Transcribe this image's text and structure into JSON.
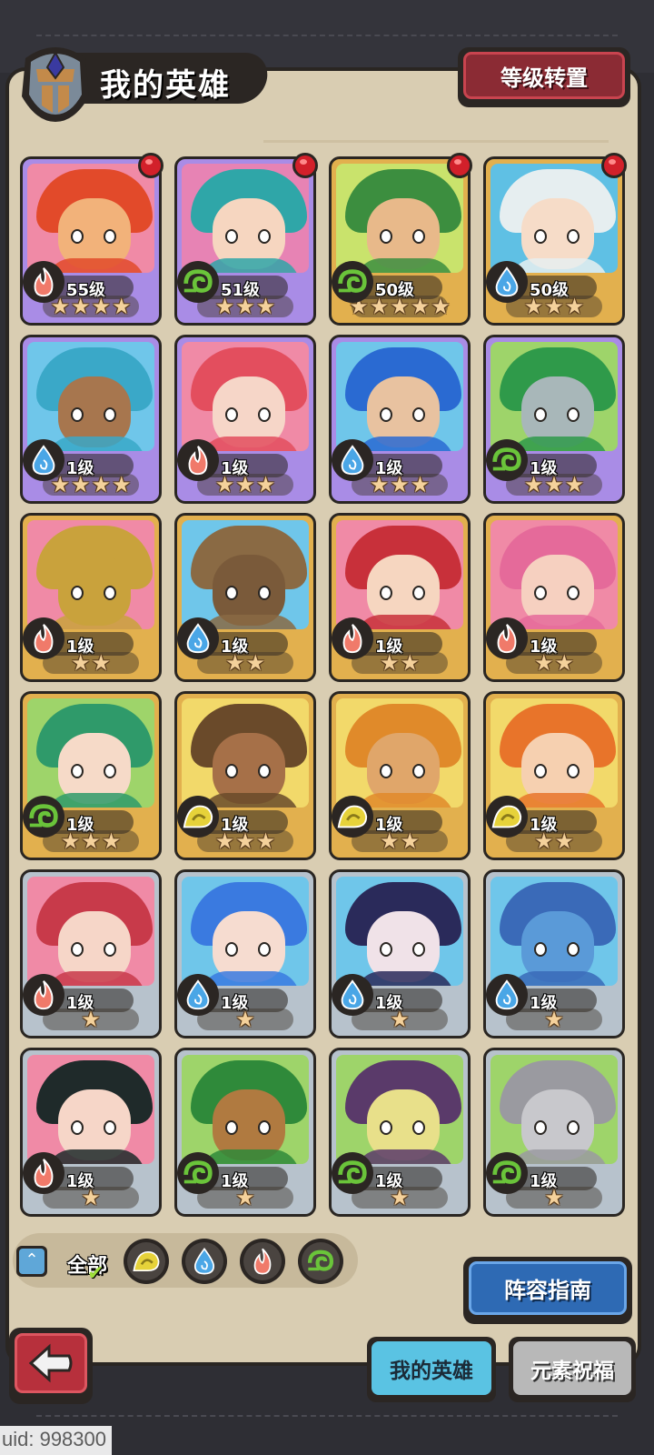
{
  "header": {
    "title": "我的英雄",
    "level_reset_label": "等级转置"
  },
  "heroes": [
    {
      "level": "55级",
      "stars": 4,
      "element": "fire",
      "frame": "purple",
      "new": true,
      "skin": "#f2b27a",
      "hair": "#e24a2a",
      "bg": "#f08aa6"
    },
    {
      "level": "51级",
      "stars": 3,
      "element": "wind",
      "frame": "purple",
      "new": true,
      "skin": "#f6d6c0",
      "hair": "#2fa6a8",
      "bg": "#e783b4"
    },
    {
      "level": "50级",
      "stars": 5,
      "element": "wind",
      "frame": "gold",
      "new": true,
      "skin": "#e8b98a",
      "hair": "#3c8e3f",
      "bg": "#c9e36c"
    },
    {
      "level": "50级",
      "stars": 3,
      "element": "water",
      "frame": "gold",
      "new": true,
      "skin": "#f6dcc8",
      "hair": "#e6eef0",
      "bg": "#5fc0e4"
    },
    {
      "level": "1级",
      "stars": 4,
      "element": "water",
      "frame": "purple",
      "new": false,
      "skin": "#a7764e",
      "hair": "#3aa8c8",
      "bg": "#6fc6ea"
    },
    {
      "level": "1级",
      "stars": 3,
      "element": "fire",
      "frame": "purple",
      "new": false,
      "skin": "#f6d6c8",
      "hair": "#e34e5e",
      "bg": "#f08aa6"
    },
    {
      "level": "1级",
      "stars": 3,
      "element": "water",
      "frame": "purple",
      "new": false,
      "skin": "#e8c2a0",
      "hair": "#2a6ad2",
      "bg": "#6fc6ea"
    },
    {
      "level": "1级",
      "stars": 3,
      "element": "wind",
      "frame": "purple",
      "new": false,
      "skin": "#a8b7b9",
      "hair": "#2f9a4a",
      "bg": "#9ed46a"
    },
    {
      "level": "1级",
      "stars": 2,
      "element": "fire",
      "frame": "gold",
      "new": false,
      "skin": "#c9a23c",
      "hair": "#c9a23c",
      "bg": "#f08aa6"
    },
    {
      "level": "1级",
      "stars": 2,
      "element": "water",
      "frame": "gold",
      "new": false,
      "skin": "#7a5a3a",
      "hair": "#8a6a44",
      "bg": "#6fc6ea"
    },
    {
      "level": "1级",
      "stars": 2,
      "element": "fire",
      "frame": "gold",
      "new": false,
      "skin": "#f6d6c0",
      "hair": "#c8303a",
      "bg": "#f08aa6"
    },
    {
      "level": "1级",
      "stars": 2,
      "element": "fire",
      "frame": "gold",
      "new": false,
      "skin": "#f6d0c0",
      "hair": "#e56a9a",
      "bg": "#f08aa6"
    },
    {
      "level": "1级",
      "stars": 3,
      "element": "wind",
      "frame": "gold",
      "new": false,
      "skin": "#f6dac8",
      "hair": "#2f9a6a",
      "bg": "#9ed46a"
    },
    {
      "level": "1级",
      "stars": 3,
      "element": "earth",
      "frame": "gold",
      "new": false,
      "skin": "#a67048",
      "hair": "#6a4a2a",
      "bg": "#f2d96a"
    },
    {
      "level": "1级",
      "stars": 2,
      "element": "earth",
      "frame": "gold",
      "new": false,
      "skin": "#e0a66a",
      "hair": "#e08a2a",
      "bg": "#f2d96a"
    },
    {
      "level": "1级",
      "stars": 2,
      "element": "earth",
      "frame": "gold",
      "new": false,
      "skin": "#f6d0b0",
      "hair": "#e8742a",
      "bg": "#f2d96a"
    },
    {
      "level": "1级",
      "stars": 1,
      "element": "fire",
      "frame": "silver",
      "new": false,
      "skin": "#f6d6c8",
      "hair": "#c83a4a",
      "bg": "#f08aa6"
    },
    {
      "level": "1级",
      "stars": 1,
      "element": "water",
      "frame": "silver",
      "new": false,
      "skin": "#f6dcd0",
      "hair": "#3a7ae0",
      "bg": "#6fc6ea"
    },
    {
      "level": "1级",
      "stars": 1,
      "element": "water",
      "frame": "silver",
      "new": false,
      "skin": "#f0e2e8",
      "hair": "#2a2a5a",
      "bg": "#6fc6ea"
    },
    {
      "level": "1级",
      "stars": 1,
      "element": "water",
      "frame": "silver",
      "new": false,
      "skin": "#5a9ad8",
      "hair": "#3a6ab8",
      "bg": "#6fc6ea"
    },
    {
      "level": "1级",
      "stars": 1,
      "element": "fire",
      "frame": "silver",
      "new": false,
      "skin": "#f6d6c8",
      "hair": "#1f2a2a",
      "bg": "#f08aa6"
    },
    {
      "level": "1级",
      "stars": 1,
      "element": "wind",
      "frame": "silver",
      "new": false,
      "skin": "#b07a40",
      "hair": "#2f8a3a",
      "bg": "#9ed46a"
    },
    {
      "level": "1级",
      "stars": 1,
      "element": "wind",
      "frame": "silver",
      "new": false,
      "skin": "#e8e08a",
      "hair": "#5a3a6a",
      "bg": "#9ed46a"
    },
    {
      "level": "1级",
      "stars": 1,
      "element": "wind",
      "frame": "silver",
      "new": false,
      "skin": "#c8c8cc",
      "hair": "#9a9aa0",
      "bg": "#9ed46a"
    }
  ],
  "filters": {
    "all_label": "全部",
    "elements": [
      "earth",
      "water",
      "fire",
      "wind"
    ]
  },
  "element_colors": {
    "fire": "#f07a6a",
    "water": "#4aa6e6",
    "wind": "#6ac43a",
    "earth": "#e6d23a"
  },
  "buttons": {
    "lineup_guide": "阵容指南"
  },
  "tabs": {
    "my_heroes": "我的英雄",
    "element_blessing": "元素祝福"
  },
  "uid_text": "uid: 998300"
}
